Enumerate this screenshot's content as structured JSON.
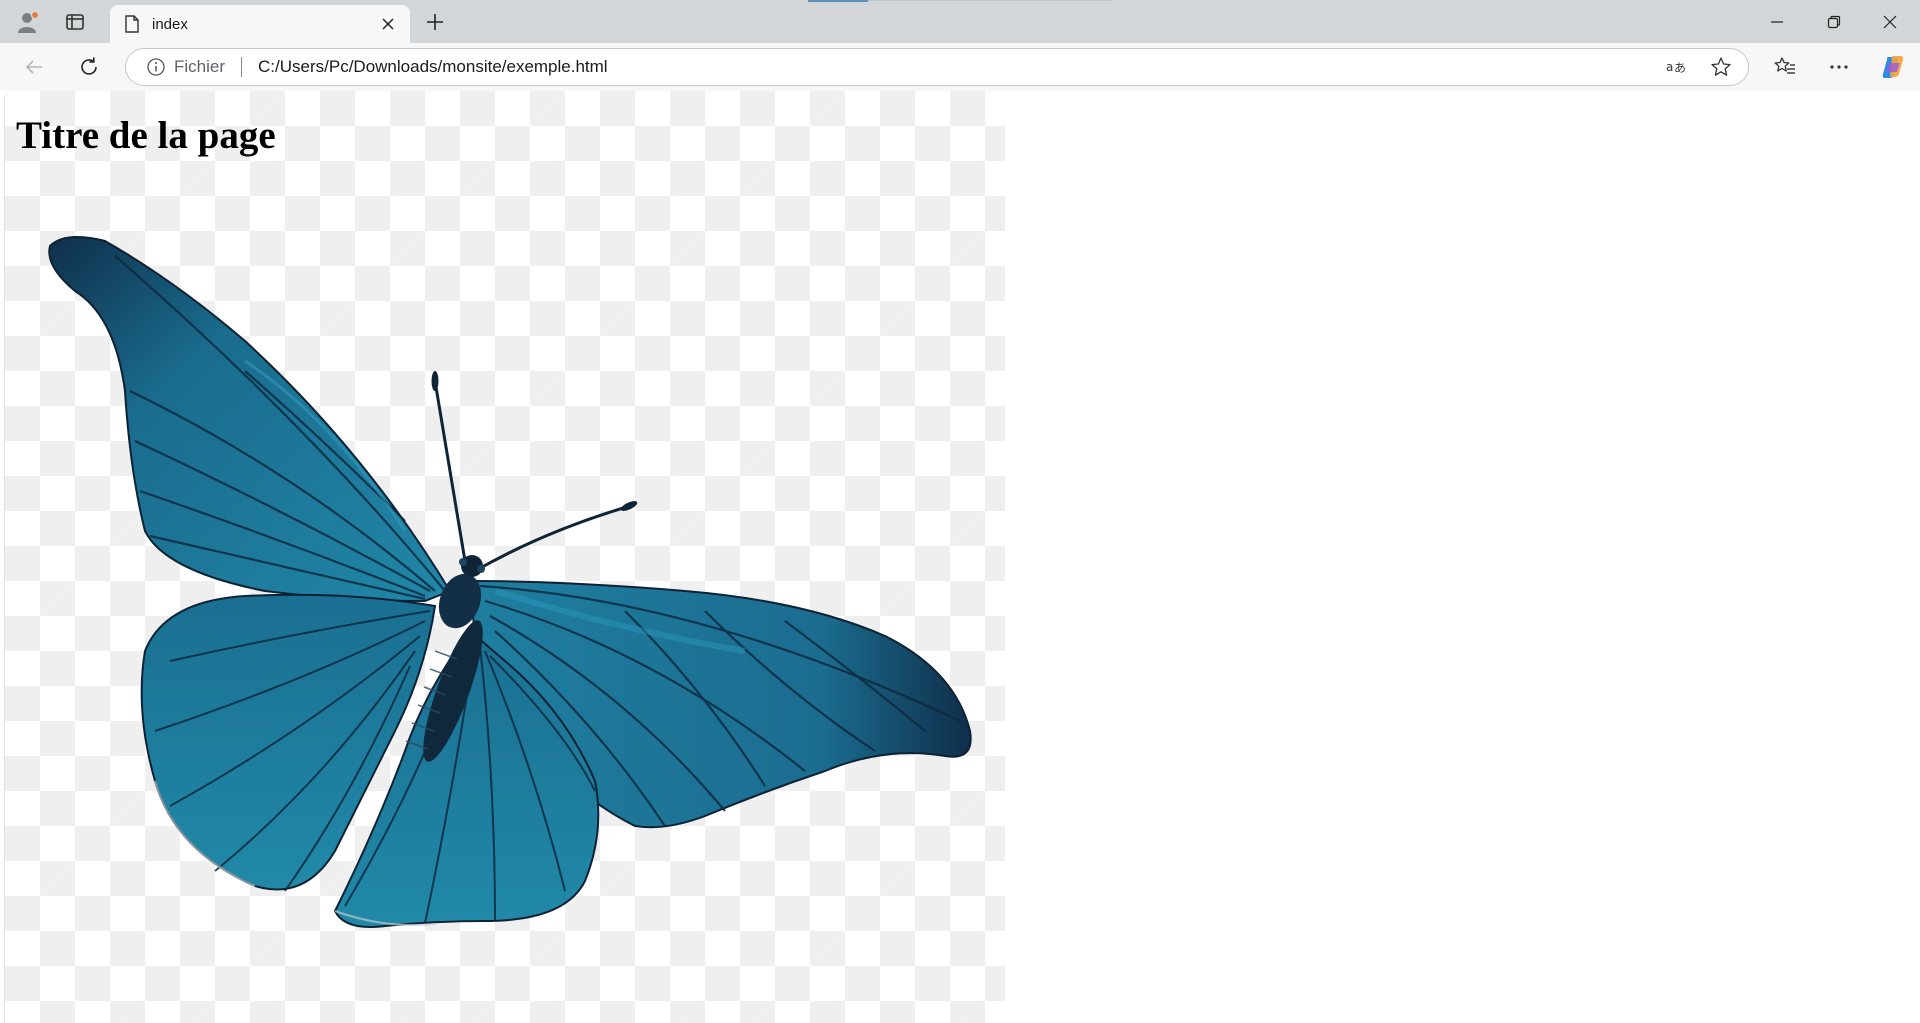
{
  "browser": {
    "tab": {
      "title": "index",
      "icon": "page-icon"
    },
    "address": {
      "site_info_label": "Fichier",
      "url": "C:/Users/Pc/Downloads/monsite/exemple.html"
    },
    "colors": {
      "chrome": "#d3d6d8",
      "toolbar": "#f7f7f7"
    }
  },
  "page": {
    "title": "Titre de la page",
    "image": {
      "subject": "butterfly-image",
      "color": "#1f7896"
    }
  }
}
